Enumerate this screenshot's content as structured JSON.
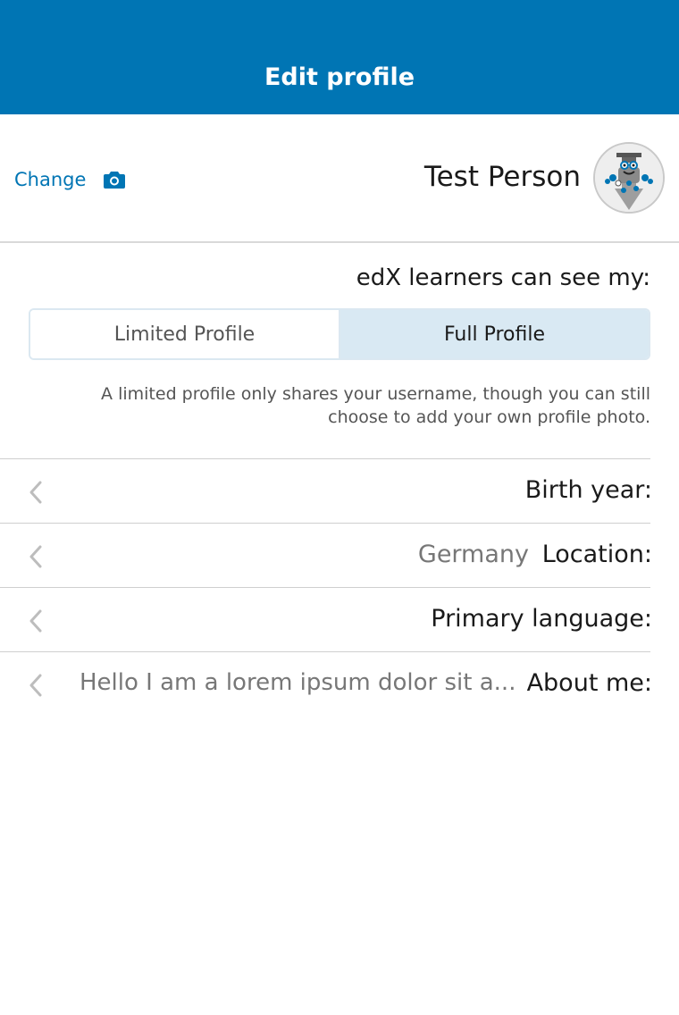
{
  "navbar": {
    "title": "Edit profile"
  },
  "header": {
    "change_label": "Change",
    "camera_icon": "camera-icon",
    "username": "Test Person",
    "avatar_icon": "profile-avatar"
  },
  "visibility": {
    "label": "edX learners can see my:",
    "options": [
      "Limited Profile",
      "Full Profile"
    ],
    "selected": "Full Profile",
    "explanation_line1": "A limited profile only shares your username, though you can still",
    "explanation_line2": "choose to add your own profile photo."
  },
  "fields": [
    {
      "label": "Birth year:",
      "value": ""
    },
    {
      "label": "Location:",
      "value": "Germany"
    },
    {
      "label": "Primary language:",
      "value": ""
    },
    {
      "label": "About me:",
      "value": "Hello I am a lorem ipsum dolor sit a..."
    }
  ],
  "colors": {
    "brand": "#0075b4",
    "segment_selected": "#d9e9f3",
    "chevron": "#bdbdbd"
  }
}
